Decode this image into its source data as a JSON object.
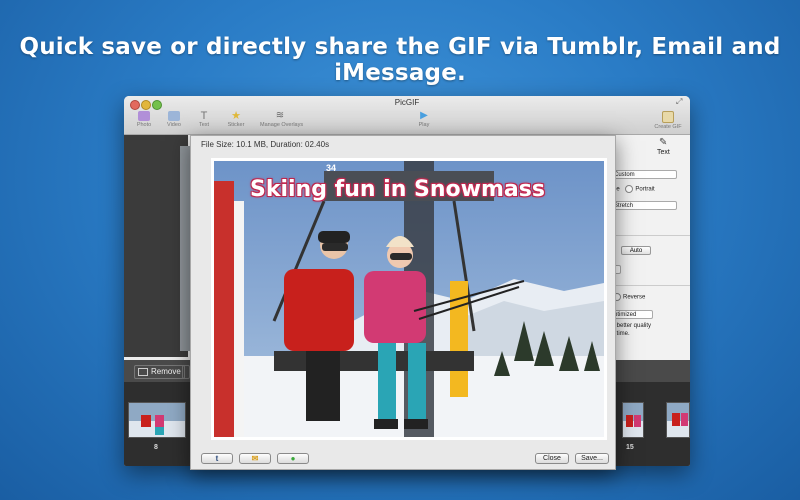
{
  "headline": "Quick save or directly share the GIF via Tumblr, Email and iMessage.",
  "window": {
    "title": "PicGIF",
    "toolbar": [
      {
        "label": "Photo",
        "icon": "photo-icon"
      },
      {
        "label": "Video",
        "icon": "video-icon"
      },
      {
        "label": "Text",
        "icon": "text-icon"
      },
      {
        "label": "Sticker",
        "icon": "sticker-icon"
      },
      {
        "label": "Manage Overlays",
        "icon": "layers-icon"
      },
      {
        "label": "Play",
        "icon": "play-icon"
      },
      {
        "label": "Create GIF",
        "icon": "gif-icon"
      }
    ],
    "right_panel": {
      "tab_label": "Text",
      "size_select": "Custom",
      "orientation_partial": "pe",
      "orientation_portrait": "Portrait",
      "fill_select": "Stretch",
      "auto_button": "Auto",
      "reverse_label": "Reverse",
      "quality_select": "ptimized",
      "quality_hint_line1": "r better quality",
      "quality_hint_line2": "r time."
    },
    "remove_label": "Remove",
    "timeline_frames": [
      "8",
      "15"
    ]
  },
  "preview": {
    "file_info": "File Size: 10.1 MB,  Duration: 02.40s",
    "caption": "Skiing fun in Snowmass",
    "chair_number": "34",
    "buttons": {
      "tumblr": "t",
      "close": "Close",
      "save": "Save..."
    }
  },
  "colors": {
    "background": "#2a7cc6",
    "caption_outline": "#d0325a",
    "jacket_red": "#c8201c",
    "jacket_pink": "#d23a73",
    "pants_teal": "#2aa5b5",
    "chair_yellow": "#f3b820"
  }
}
